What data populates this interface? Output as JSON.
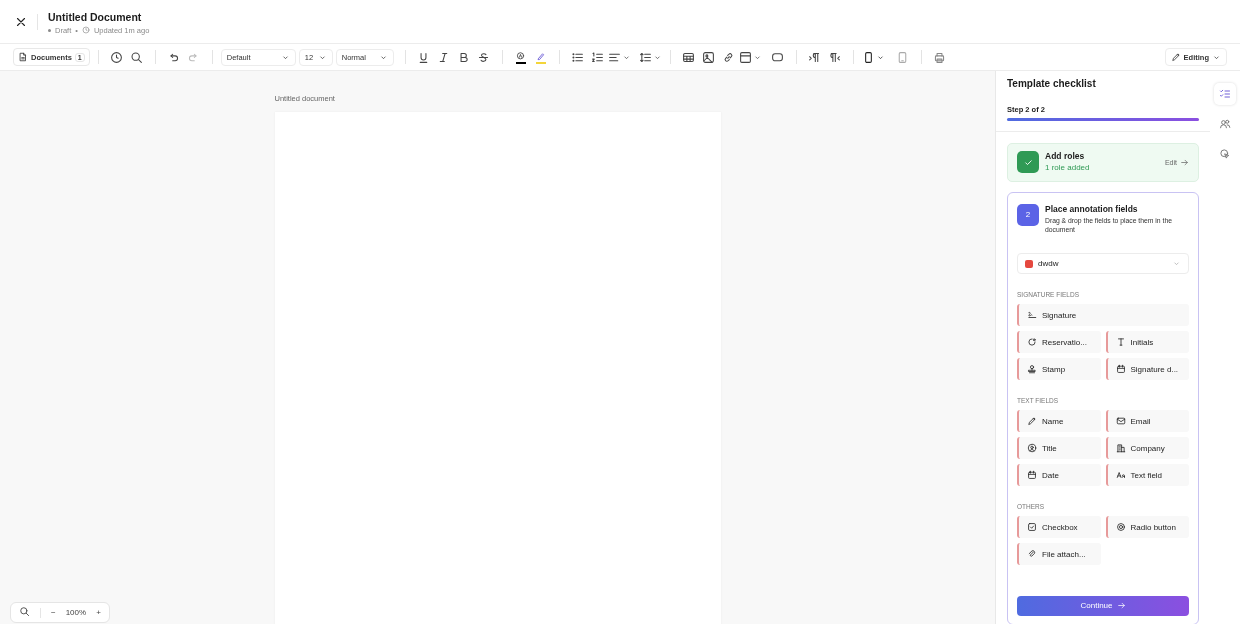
{
  "header": {
    "title": "Untitled Document",
    "status": "Draft",
    "separator": "•",
    "updated": "Updated 1m ago"
  },
  "toolbar": {
    "documents": {
      "label": "Documents",
      "count": "1"
    },
    "font": "Default",
    "size": "12",
    "style": "Normal",
    "mode": "Editing"
  },
  "document": {
    "name": "Untitled document"
  },
  "zoom": {
    "minus": "−",
    "value": "100%",
    "plus": "+"
  },
  "checklist": {
    "title": "Template checklist",
    "step_label": "Step 2 of 2",
    "level": 1,
    "steps": [
      {
        "done": true,
        "title": "Add roles",
        "subtitle": "1 role added",
        "action": "Edit"
      },
      {
        "done": false,
        "number": "2",
        "title": "Place annotation fields",
        "subtitle": "Drag & drop the fields to place them in the document"
      }
    ],
    "role": {
      "name": "dwdw",
      "color": "#e5483f"
    },
    "sections": [
      {
        "title": "SIGNATURE FIELDS",
        "fields": [
          "Signature",
          "Reservatio...",
          "Initials",
          "Stamp",
          "Signature d..."
        ]
      },
      {
        "title": "TEXT FIELDS",
        "fields": [
          "Name",
          "Email",
          "Title",
          "Company",
          "Date",
          "Text field"
        ]
      },
      {
        "title": "OTHERS",
        "fields": [
          "Checkbox",
          "Radio button",
          "File attach..."
        ]
      }
    ],
    "continue": "Continue"
  }
}
